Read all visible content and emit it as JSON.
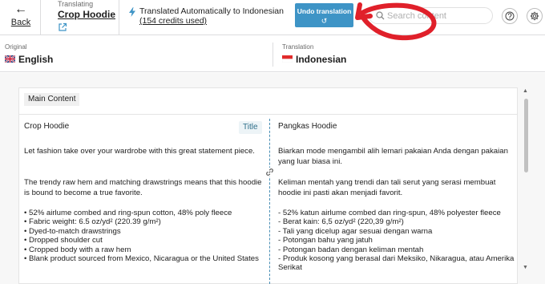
{
  "topbar": {
    "back_label": "Back",
    "breadcrumb_caption": "Translating",
    "breadcrumb_title": "Crop Hoodie",
    "status_line1": "Translated Automatically to Indonesian",
    "status_line2": "(154 credits used)",
    "undo_label": "Undo translation",
    "undo_icon": "↺",
    "search_placeholder": "Search content"
  },
  "languages": {
    "original_caption": "Original",
    "original_name": "English",
    "translation_caption": "Translation",
    "translation_name": "Indonesian"
  },
  "content": {
    "section_label": "Main Content",
    "title_badge": "Title",
    "original": {
      "title": "Crop Hoodie",
      "intro": "Let fashion take over your wardrobe with this great statement piece.",
      "para2": "The trendy raw hem and matching drawstrings means that this hoodie is bound to become a true favorite.",
      "bullets": [
        "• 52% airlume combed and ring-spun cotton, 48% poly fleece",
        "• Fabric weight: 6.5 oz/yd² (220.39 g/m²)",
        "• Dyed-to-match drawstrings",
        "• Dropped shoulder cut",
        "• Cropped body with a raw hem",
        "• Blank product sourced from Mexico, Nicaragua or the United States"
      ]
    },
    "translation": {
      "title": "Pangkas Hoodie",
      "intro": "Biarkan mode mengambil alih lemari pakaian Anda dengan pakaian yang luar biasa ini.",
      "para2": "Keliman mentah yang trendi dan tali serut yang serasi membuat hoodie ini pasti akan menjadi favorit.",
      "bullets": [
        "- 52% katun airlume combed dan ring-spun, 48% polyester fleece",
        "- Berat kain: 6,5 oz/yd² (220,39 g/m²)",
        "- Tali yang dicelup agar sesuai dengan warna",
        "- Potongan bahu yang jatuh",
        "- Potongan badan dengan keliman mentah",
        "- Produk kosong yang berasal dari Meksiko, Nikaragua, atau Amerika",
        "Serikat"
      ]
    }
  },
  "colors": {
    "accent": "#3e94c6",
    "annotation": "#e0202a"
  }
}
